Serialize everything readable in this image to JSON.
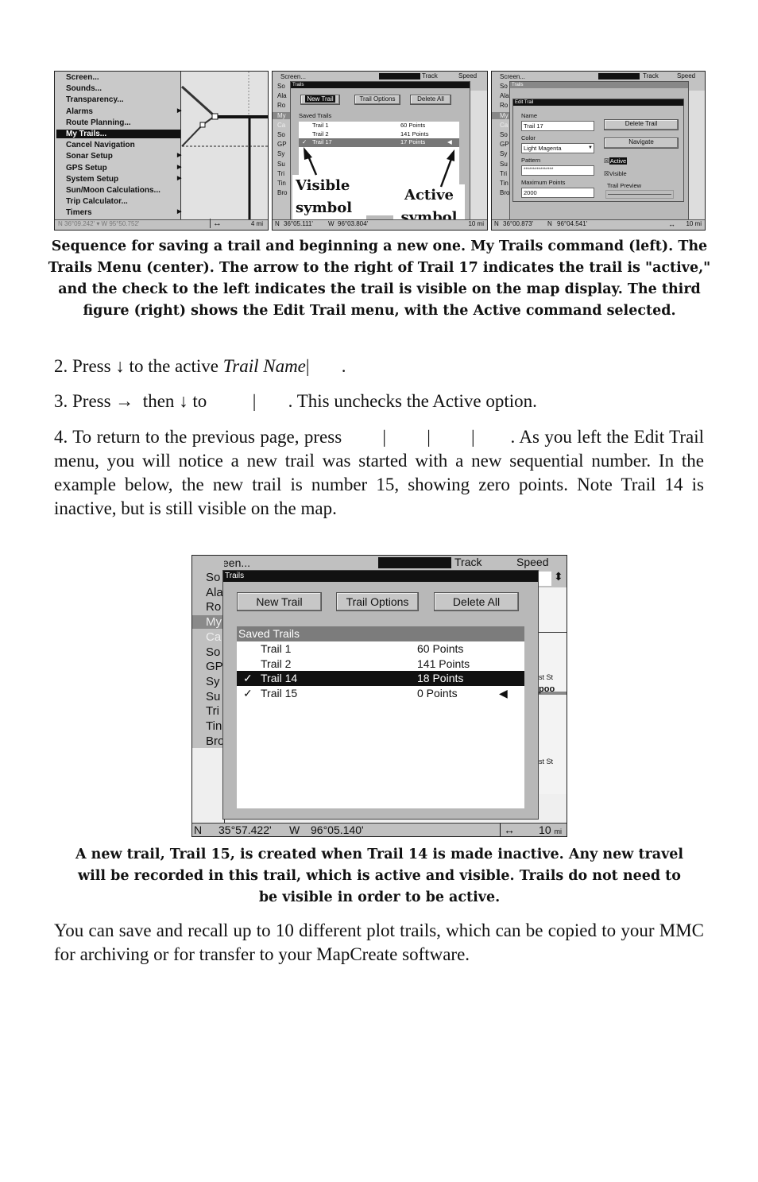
{
  "figure1": {
    "menu_items": [
      {
        "label": "Screen...",
        "submenu": false
      },
      {
        "label": "Sounds...",
        "submenu": false
      },
      {
        "label": "Transparency...",
        "submenu": false
      },
      {
        "label": "Alarms",
        "submenu": true
      },
      {
        "label": "Route Planning...",
        "submenu": false
      },
      {
        "label": "My Trails...",
        "submenu": false,
        "selected": true
      },
      {
        "label": "Cancel Navigation",
        "submenu": false
      },
      {
        "label": "Sonar Setup",
        "submenu": true
      },
      {
        "label": "GPS Setup",
        "submenu": true
      },
      {
        "label": "System Setup",
        "submenu": true
      },
      {
        "label": "Sun/Moon Calculations...",
        "submenu": false
      },
      {
        "label": "Trip Calculator...",
        "submenu": false
      },
      {
        "label": "Timers",
        "submenu": true
      }
    ],
    "status": {
      "lat": "36°09.242'",
      "lon": "95°50.752'",
      "scale": "4 mi"
    }
  },
  "figure2": {
    "header": {
      "menu_first": "Screen...",
      "track": "Track",
      "speed": "Speed"
    },
    "left_stub": [
      "So",
      "Ala",
      "Ro",
      "My",
      "Ca",
      "So",
      "GP",
      "Sy",
      "Su",
      "Tri",
      "Tin",
      "Bro"
    ],
    "dialog_title": "Trails",
    "buttons": {
      "new_trail": "New Trail",
      "trail_options": "Trail Options",
      "delete_all": "Delete All"
    },
    "list_header": "Saved Trails",
    "trails": [
      {
        "name": "Trail 1",
        "points": "60 Points",
        "visible": false,
        "active": false
      },
      {
        "name": "Trail 2",
        "points": "141 Points",
        "visible": false,
        "active": false
      },
      {
        "name": "Trail 17",
        "points": "17 Points",
        "visible": true,
        "active": true
      }
    ],
    "callouts": {
      "visible": "Visible symbol",
      "active": "Active symbol"
    },
    "status": {
      "lat_prefix": "N",
      "lat": "36°05.111'",
      "lon_prefix": "W",
      "lon": "96°03.804'",
      "scale": "10 mi"
    }
  },
  "figure3": {
    "header": {
      "menu_first": "Screen...",
      "track": "Track",
      "speed": "Speed"
    },
    "left_stub": [
      "So",
      "Ala",
      "Ro",
      "My",
      "Ca",
      "So",
      "GP",
      "Sy",
      "Su",
      "Tri",
      "Tin",
      "Bro"
    ],
    "trails_title": "Trails",
    "bg_buttons": {
      "new_trail": "New Trail",
      "trail_options": "Trail Options",
      "delete_all": "Delete All"
    },
    "dialog_title": "Edit Trail",
    "name_label": "Name",
    "name_value": "Trail 17",
    "color_label": "Color",
    "color_value": "Light Magenta",
    "pattern_label": "Pattern",
    "pattern_value": "****************",
    "max_points_label": "Maximum Points",
    "max_points_value": "2000",
    "delete_trail": "Delete Trail",
    "navigate": "Navigate",
    "active_label": "Active",
    "active_checked": true,
    "visible_label": "Visible",
    "visible_checked": true,
    "trail_preview": "Trail Preview",
    "status": {
      "lat_prefix": "N",
      "lat": "36°00.873'",
      "lon_prefix": "N",
      "lon": "96°04.541'",
      "scale": "10 mi"
    }
  },
  "caption1": "Sequence for saving a trail and beginning a new one. My Trails command (left). The Trails Menu (center). The arrow to the right of Trail 17 indicates the trail is \"active,\" and the check to the left indicates the trail is visible on the map display. The third figure (right) shows the Edit Trail menu, with the Active command selected.",
  "step2": {
    "prefix": "2. Press ↓ to the active ",
    "italic": "Trail Name",
    "suffix": "|       ."
  },
  "step3": "3. Press →  then ↓ to          |       . This unchecks the Active option.",
  "step4": "4. To return to the previous page, press        |        |        |       . As you left the Edit Trail menu, you will notice a new trail was started with a new sequential number. In the example below, the new trail is number 15, showing zero points. Note Trail 14 is inactive, but is still visible on the map.",
  "figure4": {
    "header": {
      "menu_first": "Screen...",
      "track": "Track",
      "speed": "Speed"
    },
    "left_stub": [
      "So",
      "Ala",
      "Ro",
      "My",
      "Ca",
      "So",
      "GP",
      "Sy",
      "Su",
      "Tri",
      "Tin",
      "Bro"
    ],
    "dialog_title": "Trails",
    "buttons": {
      "new_trail": "New Trail",
      "trail_options": "Trail Options",
      "delete_all": "Delete All"
    },
    "list_header": "Saved Trails",
    "trails": [
      {
        "name": "Trail 1",
        "points": "60 Points",
        "visible": false,
        "active": false
      },
      {
        "name": "Trail 2",
        "points": "141 Points",
        "visible": false,
        "active": false
      },
      {
        "name": "Trail 14",
        "points": "18 Points",
        "visible": true,
        "active": false,
        "selected": true
      },
      {
        "name": "Trail 15",
        "points": "0 Points",
        "visible": true,
        "active": true
      }
    ],
    "map_labels": [
      "st St",
      "poo",
      "st St"
    ],
    "status": {
      "lat_prefix": "N",
      "lat": "35°57.422'",
      "lon_prefix": "W",
      "lon": "96°05.140'",
      "scale": "10",
      "scale_unit": "mi"
    }
  },
  "caption2": "A new trail, Trail 15, is created when Trail 14 is made inactive. Any new travel will be recorded in this trail, which is active and visible. Trails do not need to be visible in order to be active.",
  "closing": "You can save and recall up to 10 different plot trails, which can be copied to your MMC for archiving or for transfer to your MapCreate software.",
  "icons": {
    "check": "✓",
    "active_arrow": "◀",
    "double_arrow": "↔",
    "updown": "⬍",
    "dropdown": "▼"
  }
}
